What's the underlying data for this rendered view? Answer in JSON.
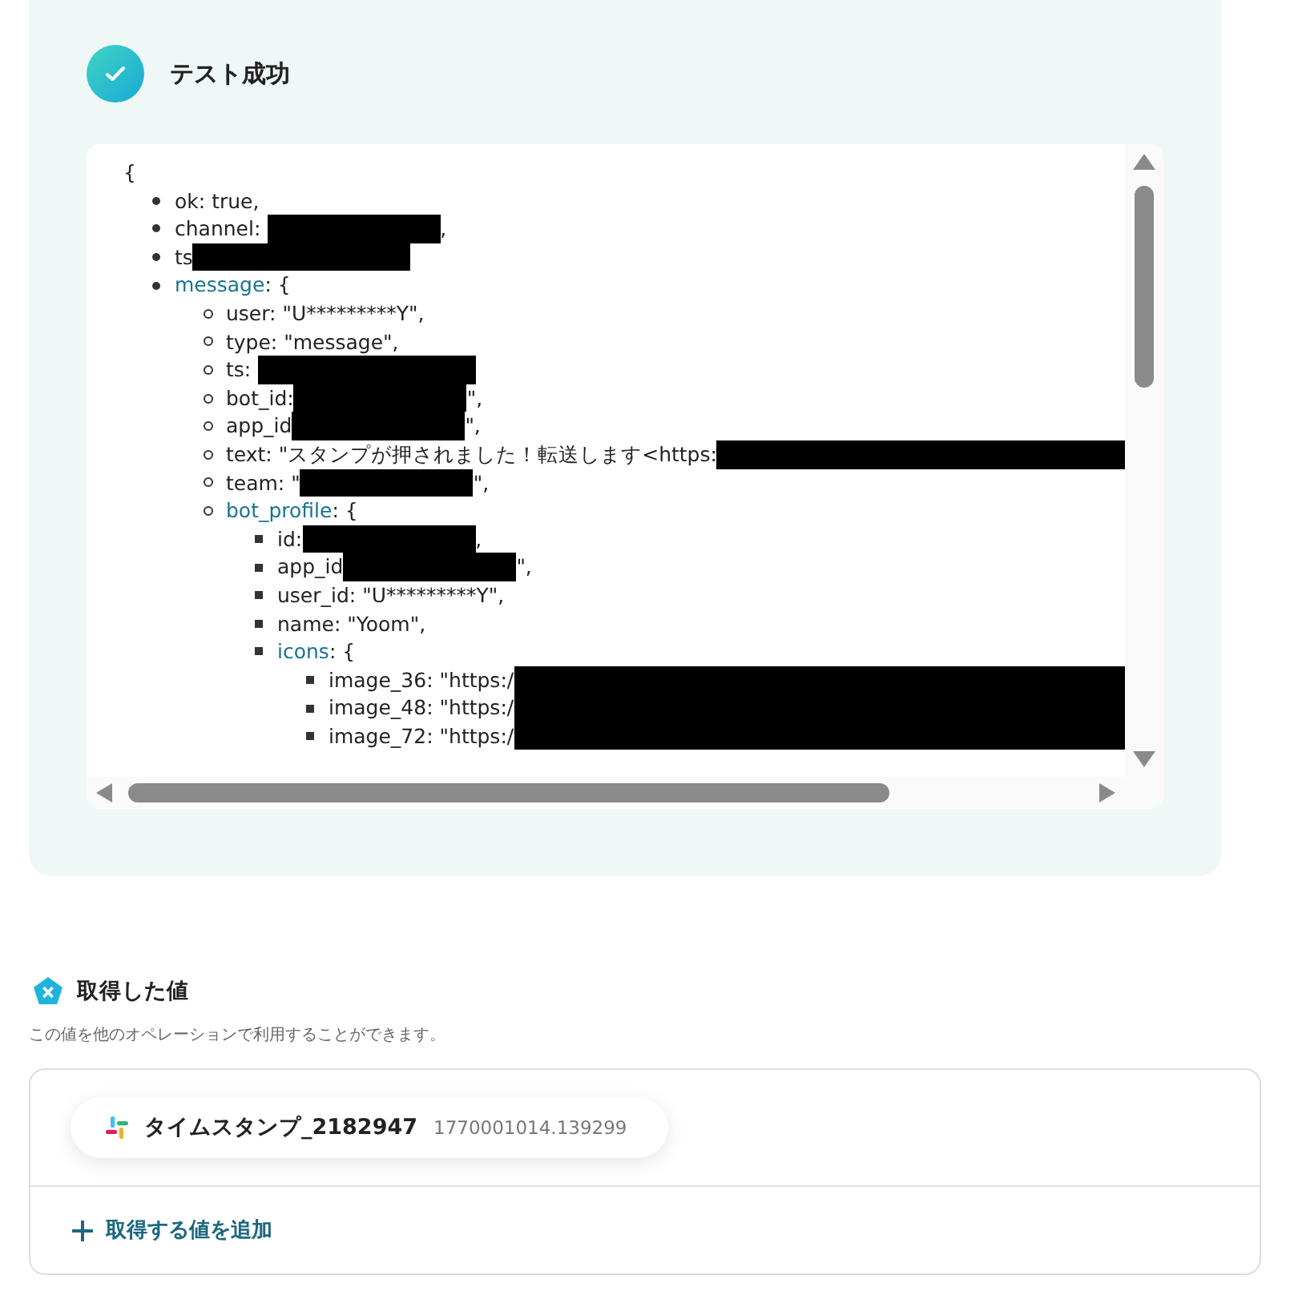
{
  "test_result": {
    "title": "テスト成功",
    "open_brace": "{",
    "lines": [
      {
        "text": "ok: true,"
      },
      {
        "text": "channel: ",
        "kind": "short_redaction",
        "suffix": ","
      },
      {
        "text": "ts",
        "kind": "long_redaction"
      },
      {
        "key": "message",
        "text": ": {",
        "children": [
          {
            "text": "user: \"U*********Y\","
          },
          {
            "text": "type: \"message\","
          },
          {
            "text": "ts: ",
            "kind": "long_redaction"
          },
          {
            "text": "bot_id:",
            "kind": "short_redaction",
            "suffix": "\","
          },
          {
            "text": "app_id",
            "kind": "short_redaction",
            "suffix": "\","
          },
          {
            "text": "text: \"スタンプが押されました！転送します<https:",
            "kind": "wide_redaction"
          },
          {
            "text": "team: \"",
            "kind": "short_redaction",
            "suffix": "\","
          },
          {
            "key": "bot_profile",
            "text": ": {",
            "children": [
              {
                "text": "id:",
                "kind": "short_redaction",
                "suffix": ","
              },
              {
                "text": "app_id",
                "kind": "short_redaction",
                "suffix": "\","
              },
              {
                "text": "user_id: \"U*********Y\","
              },
              {
                "text": "name: \"Yoom\","
              },
              {
                "key": "icons",
                "text": ": {",
                "children": [
                  {
                    "text": "image_36: \"https:/",
                    "kind": "wide_redaction"
                  },
                  {
                    "text": "image_48: \"https:/",
                    "kind": "wide_redaction"
                  },
                  {
                    "text": "image_72: \"https:/",
                    "kind": "wide_redaction"
                  }
                ]
              }
            ]
          }
        ]
      }
    ]
  },
  "acquired": {
    "title": "取得した値",
    "description": "この値を他のオペレーションで利用することができます。",
    "values": [
      {
        "name": "タイムスタンプ_2182947",
        "value": "1770001014.139299"
      }
    ],
    "add_button": "取得する値を追加"
  }
}
